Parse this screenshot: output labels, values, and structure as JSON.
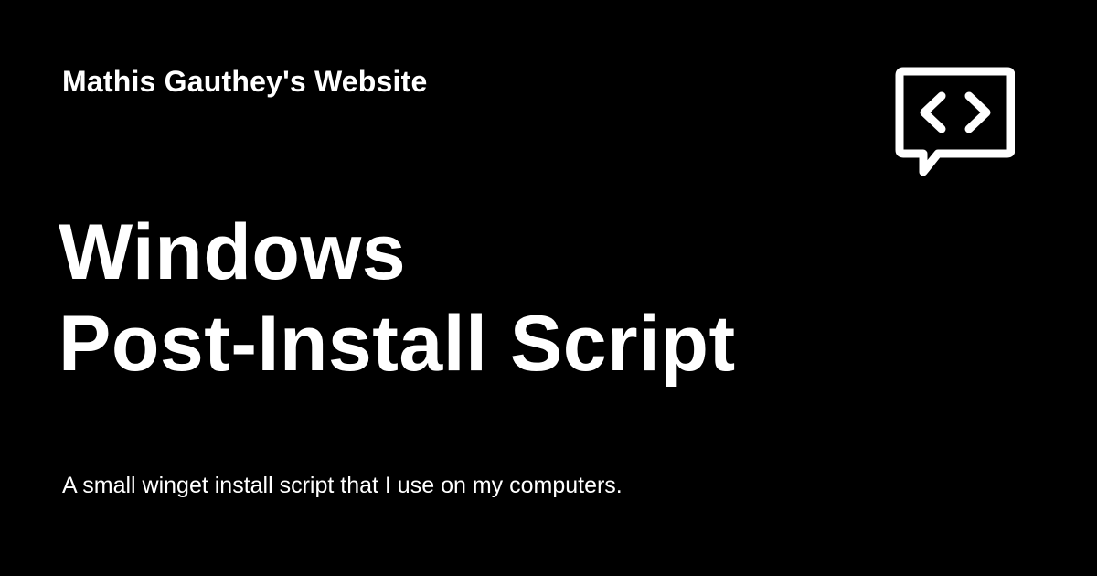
{
  "site": {
    "name": "Mathis Gauthey's Website"
  },
  "post": {
    "title_line_1": "Windows",
    "title_line_2": "Post-Install Script",
    "description": "A small winget install script that I use on my computers."
  },
  "logo": {
    "icon": "code-chat-bubble-icon"
  },
  "colors": {
    "background": "#000000",
    "foreground": "#ffffff"
  }
}
